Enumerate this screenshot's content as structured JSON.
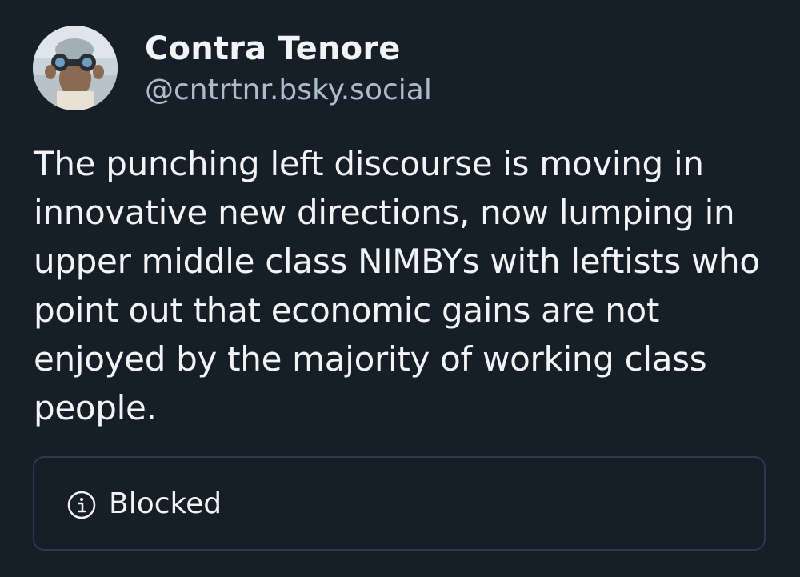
{
  "author": {
    "display_name": "Contra Tenore",
    "handle": "@cntrtnr.bsky.social",
    "avatar_icon": "avatar-person-with-binoculars"
  },
  "post": {
    "text": "The punching left discourse is moving in innovative new directions, now lumping in upper middle class NIMBYs with leftists who point out that economic gains are not enjoyed by the majority of working class people."
  },
  "embed": {
    "status_icon": "info-icon",
    "status_label": "Blocked"
  },
  "colors": {
    "background": "#161e27",
    "text_primary": "#f1f3f5",
    "text_secondary": "#aebbc9",
    "card_border": "#2e3a47"
  }
}
